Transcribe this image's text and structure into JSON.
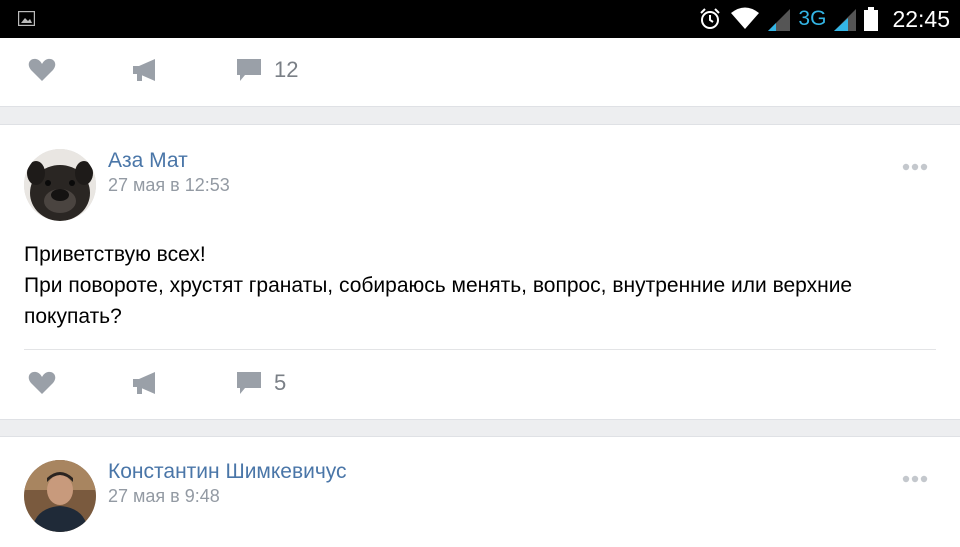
{
  "status_bar": {
    "network_type": "3G",
    "time": "22:45",
    "icons": [
      "image-icon",
      "alarm-icon",
      "wifi-icon",
      "signal-icon",
      "battery-icon"
    ]
  },
  "post_top": {
    "comment_count": "12"
  },
  "post_1": {
    "author": "Аза Мат",
    "date": "27 мая в 12:53",
    "text_lines": [
      "Приветствую всех!",
      "При повороте, хрустят гранаты, собираюсь менять, вопрос, внутренние или верхние",
      "покупать?"
    ],
    "comment_count": "5"
  },
  "post_2": {
    "author": "Константин Шимкевичус",
    "date": "27 мая в 9:48"
  },
  "colors": {
    "link": "#4a76a8",
    "meta": "#939aa3",
    "icon": "#9aa0a8",
    "network": "#33b5e5"
  }
}
